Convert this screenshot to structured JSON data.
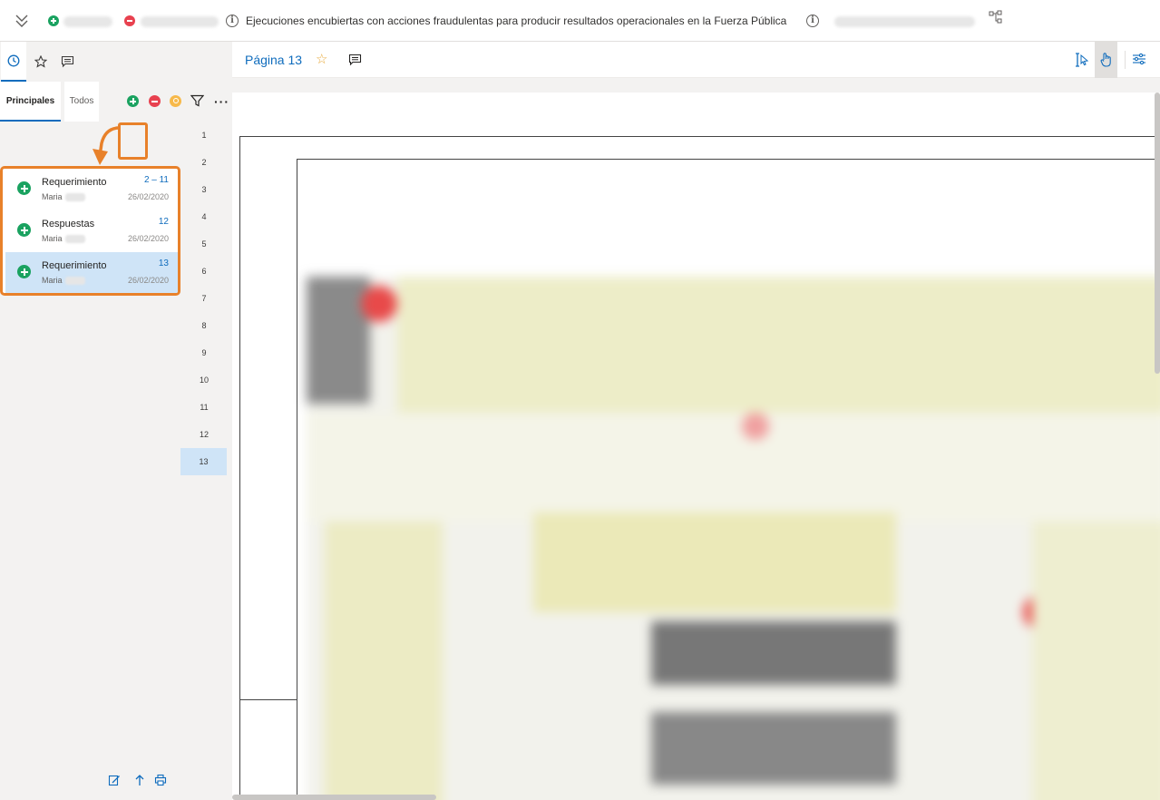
{
  "topbar": {
    "document_title": "Ejecuciones encubiertas con acciones fraudulentas para producir resultados operacionales en la Fuerza Pública",
    "icons": [
      "chevron-double-down-icon",
      "add-icon",
      "remove-icon",
      "info-icon",
      "info-icon",
      "hierarchy-icon"
    ]
  },
  "left_panel": {
    "tabs": [
      "clock-icon",
      "star-icon",
      "comment-icon"
    ],
    "subtabs": {
      "principales": "Principales",
      "todos": "Todos"
    },
    "toolbar_icons": [
      "add-icon",
      "remove-icon",
      "key-icon",
      "filter-icon",
      "more-icon"
    ],
    "cards": [
      {
        "title": "Requerimiento",
        "user": "Maria",
        "pages": "2 – 11",
        "date": "26/02/2020",
        "selected": false
      },
      {
        "title": "Respuestas",
        "user": "Maria",
        "pages": "12",
        "date": "26/02/2020",
        "selected": false
      },
      {
        "title": "Requerimiento",
        "user": "Maria",
        "pages": "13",
        "date": "26/02/2020",
        "selected": true
      }
    ],
    "footer_icons": [
      "edit-icon",
      "upload-icon",
      "print-icon"
    ],
    "page_numbers": [
      "1",
      "2",
      "3",
      "4",
      "5",
      "6",
      "7",
      "8",
      "9",
      "10",
      "11",
      "12",
      "13"
    ],
    "active_page": "13"
  },
  "viewer": {
    "page_label": "Página 13",
    "colors": {
      "accent": "#0f6cbd",
      "highlight": "#e8812a",
      "add": "#1aa260",
      "remove": "#e8414f",
      "selected": "#cfe4f7"
    }
  }
}
